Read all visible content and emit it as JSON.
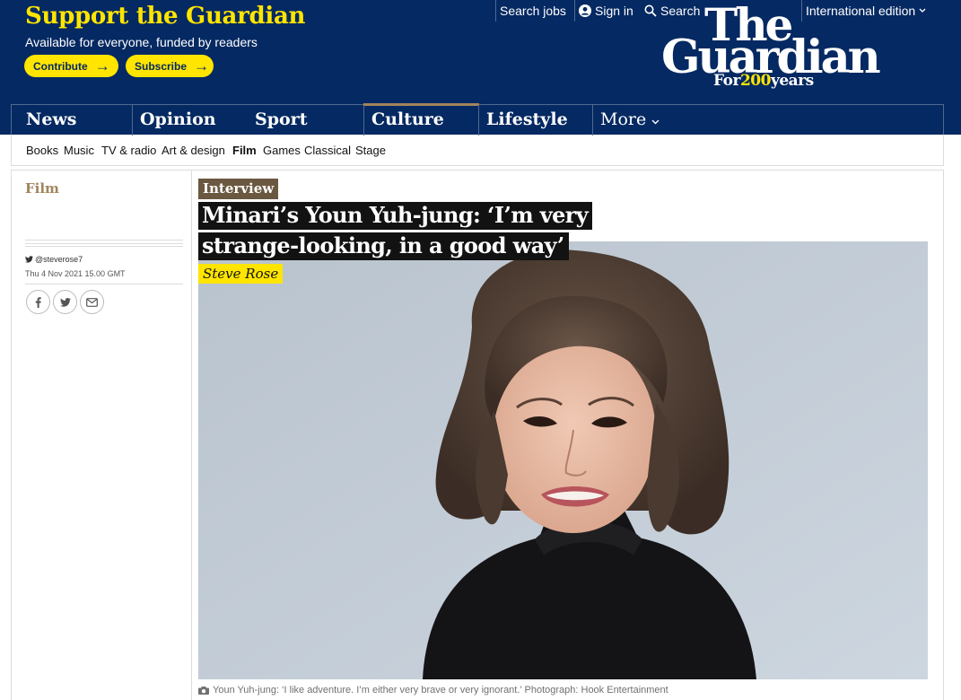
{
  "support": {
    "title": "Support the Guardian",
    "subtitle": "Available for everyone, funded by readers",
    "contribute_label": "Contribute",
    "subscribe_label": "Subscribe"
  },
  "topnav": {
    "jobs": "Search jobs",
    "sign_in": "Sign in",
    "search": "Search",
    "edition": "International edition"
  },
  "logo": {
    "line1": "The",
    "line2": "Guardian",
    "tag_prefix": "For",
    "tag_number": "200",
    "tag_suffix": "years"
  },
  "pillars": [
    "News",
    "Opinion",
    "Sport",
    "Culture",
    "Lifestyle",
    "More"
  ],
  "subnav": [
    "Books",
    "Music",
    "TV & radio",
    "Art & design",
    "Film",
    "Games",
    "Classical",
    "Stage"
  ],
  "article": {
    "section": "Film",
    "twitter": "@steverose7",
    "date": "Thu 4 Nov 2021 15.00 GMT",
    "kicker": "Interview",
    "headline": "Minari’s Youn Yuh-jung: ‘I’m very strange-looking, in a good way’",
    "byline": "Steve Rose",
    "caption": "Youn Yuh-jung: ‘I like adventure. I’m either very brave or very ignorant.’ Photograph: Hook Entertainment"
  },
  "colors": {
    "brand_blue": "#052962",
    "highlight_yellow": "#ffe500",
    "culture_accent": "#a1845c"
  }
}
